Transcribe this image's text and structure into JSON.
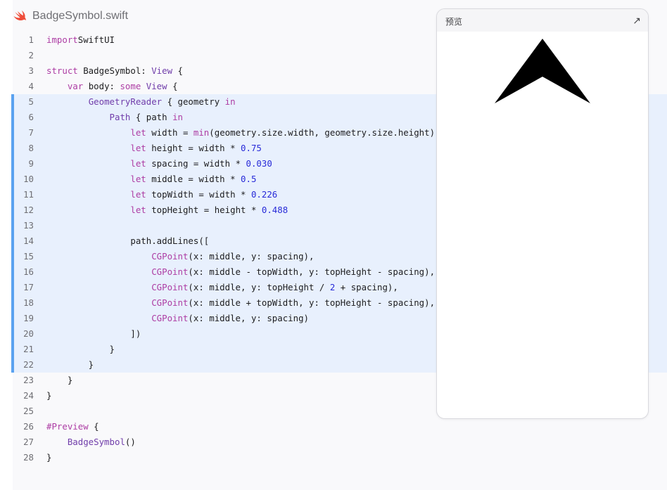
{
  "file": {
    "icon": "swift-logo-icon",
    "name": "BadgeSymbol.swift"
  },
  "code_lines": [
    {
      "n": "1",
      "hl": false,
      "tokens": [
        [
          "kw",
          "import"
        ],
        [
          "",
          "SwiftUI"
        ]
      ]
    },
    {
      "n": "2",
      "hl": false,
      "tokens": []
    },
    {
      "n": "3",
      "hl": false,
      "tokens": [
        [
          "kw",
          "struct"
        ],
        [
          "",
          " BadgeSymbol: "
        ],
        [
          "ty",
          "View"
        ],
        [
          "",
          " {"
        ]
      ]
    },
    {
      "n": "4",
      "hl": false,
      "tokens": [
        [
          "",
          "    "
        ],
        [
          "kw",
          "var"
        ],
        [
          "",
          " body: "
        ],
        [
          "kw",
          "some"
        ],
        [
          "",
          " "
        ],
        [
          "ty",
          "View"
        ],
        [
          "",
          " {"
        ]
      ]
    },
    {
      "n": "5",
      "hl": true,
      "tokens": [
        [
          "",
          "        "
        ],
        [
          "ty",
          "GeometryReader"
        ],
        [
          "",
          " { geometry "
        ],
        [
          "kw",
          "in"
        ]
      ]
    },
    {
      "n": "6",
      "hl": true,
      "tokens": [
        [
          "",
          "            "
        ],
        [
          "ty",
          "Path"
        ],
        [
          "",
          " { path "
        ],
        [
          "kw",
          "in"
        ]
      ]
    },
    {
      "n": "7",
      "hl": true,
      "tokens": [
        [
          "",
          "                "
        ],
        [
          "kw",
          "let"
        ],
        [
          "",
          " width = "
        ],
        [
          "kw",
          "min"
        ],
        [
          "",
          "(geometry.size.width, geometry.size.height)"
        ]
      ]
    },
    {
      "n": "8",
      "hl": true,
      "tokens": [
        [
          "",
          "                "
        ],
        [
          "kw",
          "let"
        ],
        [
          "",
          " height = width * "
        ],
        [
          "num",
          "0.75"
        ]
      ]
    },
    {
      "n": "9",
      "hl": true,
      "tokens": [
        [
          "",
          "                "
        ],
        [
          "kw",
          "let"
        ],
        [
          "",
          " spacing = width * "
        ],
        [
          "num",
          "0.030"
        ]
      ]
    },
    {
      "n": "10",
      "hl": true,
      "tokens": [
        [
          "",
          "                "
        ],
        [
          "kw",
          "let"
        ],
        [
          "",
          " middle = width * "
        ],
        [
          "num",
          "0.5"
        ]
      ]
    },
    {
      "n": "11",
      "hl": true,
      "tokens": [
        [
          "",
          "                "
        ],
        [
          "kw",
          "let"
        ],
        [
          "",
          " topWidth = width * "
        ],
        [
          "num",
          "0.226"
        ]
      ]
    },
    {
      "n": "12",
      "hl": true,
      "tokens": [
        [
          "",
          "                "
        ],
        [
          "kw",
          "let"
        ],
        [
          "",
          " topHeight = height * "
        ],
        [
          "num",
          "0.488"
        ]
      ]
    },
    {
      "n": "13",
      "hl": true,
      "tokens": []
    },
    {
      "n": "14",
      "hl": true,
      "tokens": [
        [
          "",
          "                path.addLines(["
        ]
      ]
    },
    {
      "n": "15",
      "hl": true,
      "tokens": [
        [
          "",
          "                    "
        ],
        [
          "kw",
          "CGPoint"
        ],
        [
          "",
          "(x: middle, y: spacing),"
        ]
      ]
    },
    {
      "n": "16",
      "hl": true,
      "tokens": [
        [
          "",
          "                    "
        ],
        [
          "kw",
          "CGPoint"
        ],
        [
          "",
          "(x: middle - topWidth, y: topHeight - spacing),"
        ]
      ]
    },
    {
      "n": "17",
      "hl": true,
      "tokens": [
        [
          "",
          "                    "
        ],
        [
          "kw",
          "CGPoint"
        ],
        [
          "",
          "(x: middle, y: topHeight / "
        ],
        [
          "num",
          "2"
        ],
        [
          "",
          " + spacing),"
        ]
      ]
    },
    {
      "n": "18",
      "hl": true,
      "tokens": [
        [
          "",
          "                    "
        ],
        [
          "kw",
          "CGPoint"
        ],
        [
          "",
          "(x: middle + topWidth, y: topHeight - spacing),"
        ]
      ]
    },
    {
      "n": "19",
      "hl": true,
      "tokens": [
        [
          "",
          "                    "
        ],
        [
          "kw",
          "CGPoint"
        ],
        [
          "",
          "(x: middle, y: spacing)"
        ]
      ]
    },
    {
      "n": "20",
      "hl": true,
      "tokens": [
        [
          "",
          "                ])"
        ]
      ]
    },
    {
      "n": "21",
      "hl": true,
      "tokens": [
        [
          "",
          "            }"
        ]
      ]
    },
    {
      "n": "22",
      "hl": true,
      "tokens": [
        [
          "",
          "        }"
        ]
      ]
    },
    {
      "n": "23",
      "hl": false,
      "tokens": [
        [
          "",
          "    }"
        ]
      ]
    },
    {
      "n": "24",
      "hl": false,
      "tokens": [
        [
          "",
          "}"
        ]
      ]
    },
    {
      "n": "25",
      "hl": false,
      "tokens": []
    },
    {
      "n": "26",
      "hl": false,
      "tokens": [
        [
          "kw",
          "#Preview"
        ],
        [
          "",
          " {"
        ]
      ]
    },
    {
      "n": "27",
      "hl": false,
      "tokens": [
        [
          "",
          "    "
        ],
        [
          "ty",
          "BadgeSymbol"
        ],
        [
          "",
          "()"
        ]
      ]
    },
    {
      "n": "28",
      "hl": false,
      "tokens": [
        [
          "",
          "}"
        ]
      ]
    }
  ],
  "preview": {
    "title": "预览",
    "expand_icon": "↗",
    "shape_color": "#000000"
  }
}
